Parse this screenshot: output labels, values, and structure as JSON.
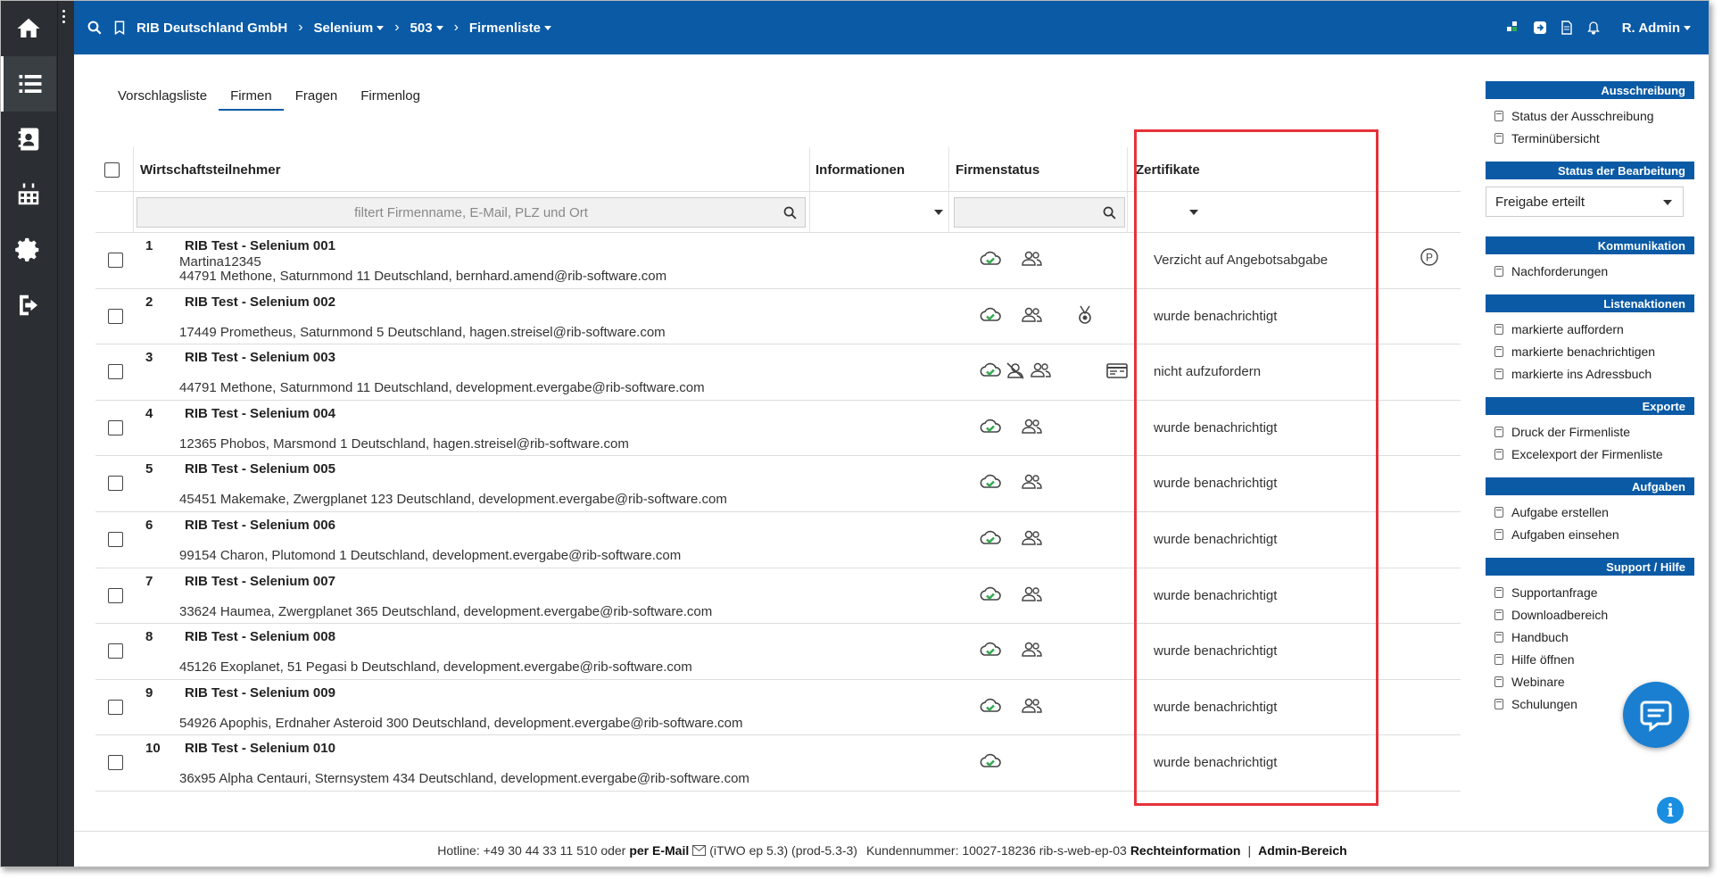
{
  "breadcrumbs": [
    "RIB Deutschland GmbH",
    "Selenium",
    "503",
    "Firmenliste"
  ],
  "user": "R. Admin",
  "tabs": [
    "Vorschlagsliste",
    "Firmen",
    "Fragen",
    "Firmenlog"
  ],
  "active_tab": "Firmen",
  "columns": {
    "company": "Wirtschaftsteilnehmer",
    "info": "Informationen",
    "status": "Firmenstatus",
    "cert": "Zertifikate"
  },
  "filter_placeholder": "filtert Firmenname, E-Mail, PLZ und Ort",
  "rows": [
    {
      "num": "1",
      "name": "RIB Test - Selenium 001",
      "contact": "Martina12345",
      "addr": "44791 Methone, Saturnmond 11 Deutschland, bernhard.amend@rib-software.com",
      "status": "Verzicht auf Angebotsabgabe"
    },
    {
      "num": "2",
      "name": "RIB Test - Selenium 002",
      "contact": "",
      "addr": "17449 Prometheus, Saturnmond 5 Deutschland, hagen.streisel@rib-software.com",
      "status": "wurde benachrichtigt"
    },
    {
      "num": "3",
      "name": "RIB Test - Selenium 003",
      "contact": "",
      "addr": "44791 Methone, Saturnmond 11 Deutschland, development.evergabe@rib-software.com",
      "status": "nicht aufzufordern"
    },
    {
      "num": "4",
      "name": "RIB Test - Selenium 004",
      "contact": "",
      "addr": "12365 Phobos, Marsmond 1 Deutschland, hagen.streisel@rib-software.com",
      "status": "wurde benachrichtigt"
    },
    {
      "num": "5",
      "name": "RIB Test - Selenium 005",
      "contact": "",
      "addr": "45451 Makemake, Zwergplanet 123 Deutschland, development.evergabe@rib-software.com",
      "status": "wurde benachrichtigt"
    },
    {
      "num": "6",
      "name": "RIB Test - Selenium 006",
      "contact": "",
      "addr": "99154 Charon, Plutomond 1 Deutschland, development.evergabe@rib-software.com",
      "status": "wurde benachrichtigt"
    },
    {
      "num": "7",
      "name": "RIB Test - Selenium 007",
      "contact": "",
      "addr": "33624 Haumea, Zwergplanet 365 Deutschland, development.evergabe@rib-software.com",
      "status": "wurde benachrichtigt"
    },
    {
      "num": "8",
      "name": "RIB Test - Selenium 008",
      "contact": "",
      "addr": "45126 Exoplanet, 51 Pegasi b Deutschland, development.evergabe@rib-software.com",
      "status": "wurde benachrichtigt"
    },
    {
      "num": "9",
      "name": "RIB Test - Selenium 009",
      "contact": "",
      "addr": "54926 Apophis, Erdnaher Asteroid 300 Deutschland, development.evergabe@rib-software.com",
      "status": "wurde benachrichtigt"
    },
    {
      "num": "10",
      "name": "RIB Test - Selenium 010",
      "contact": "",
      "addr": "36x95 Alpha Centauri, Sternsystem 434 Deutschland, development.evergabe@rib-software.com",
      "status": "wurde benachrichtigt"
    }
  ],
  "sidebar": {
    "ausschreibung": {
      "title": "Ausschreibung",
      "items": [
        "Status der Ausschreibung",
        "Terminübersicht"
      ]
    },
    "bearbeitung": {
      "title": "Status der Bearbeitung",
      "selected": "Freigabe erteilt"
    },
    "kommunikation": {
      "title": "Kommunikation",
      "items": [
        "Nachforderungen"
      ]
    },
    "listenaktionen": {
      "title": "Listenaktionen",
      "items": [
        "markierte auffordern",
        "markierte benachrichtigen",
        "markierte ins Adressbuch"
      ]
    },
    "exporte": {
      "title": "Exporte",
      "items": [
        "Druck der Firmenliste",
        "Excelexport der Firmenliste"
      ]
    },
    "aufgaben": {
      "title": "Aufgaben",
      "items": [
        "Aufgabe erstellen",
        "Aufgaben einsehen"
      ]
    },
    "support": {
      "title": "Support / Hilfe",
      "items": [
        "Supportanfrage",
        "Downloadbereich",
        "Handbuch",
        "Hilfe öffnen",
        "Webinare",
        "Schulungen"
      ]
    }
  },
  "footer": {
    "hotline": "Hotline: +49 30 44 33 11 510 oder",
    "email": "per E-Mail",
    "version": "(iTWO ep 5.3) (prod-5.3-3)",
    "customer": "Kundennummer: 10027-18236 rib-s-web-ep-03",
    "legal": "Rechteinformation",
    "divider": "|",
    "admin": "Admin-Bereich"
  },
  "colors": {
    "brand": "#0a5aa6",
    "highlight": "#e5323a",
    "ok_green": "#2fa84f"
  }
}
